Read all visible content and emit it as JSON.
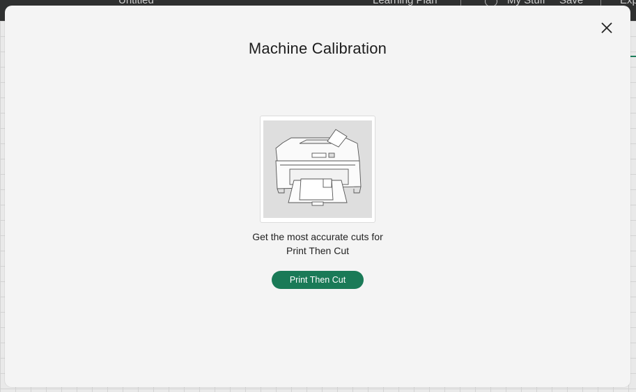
{
  "app": {
    "document_title": "Untitled*",
    "learning_plan": "Learning Plan",
    "my_stuff": "My Stuff",
    "save": "Save",
    "export_partial": "Exp"
  },
  "modal": {
    "title": "Machine Calibration",
    "description_line1": "Get the most accurate cuts for",
    "description_line2": "Print Then Cut",
    "button_label": "Print Then Cut",
    "image_icon": "printer-illustration",
    "close_icon": "close-icon"
  },
  "colors": {
    "accent": "#1a7a57",
    "modal_bg": "#f4f4f4",
    "topbar_bg": "#2f3030"
  }
}
